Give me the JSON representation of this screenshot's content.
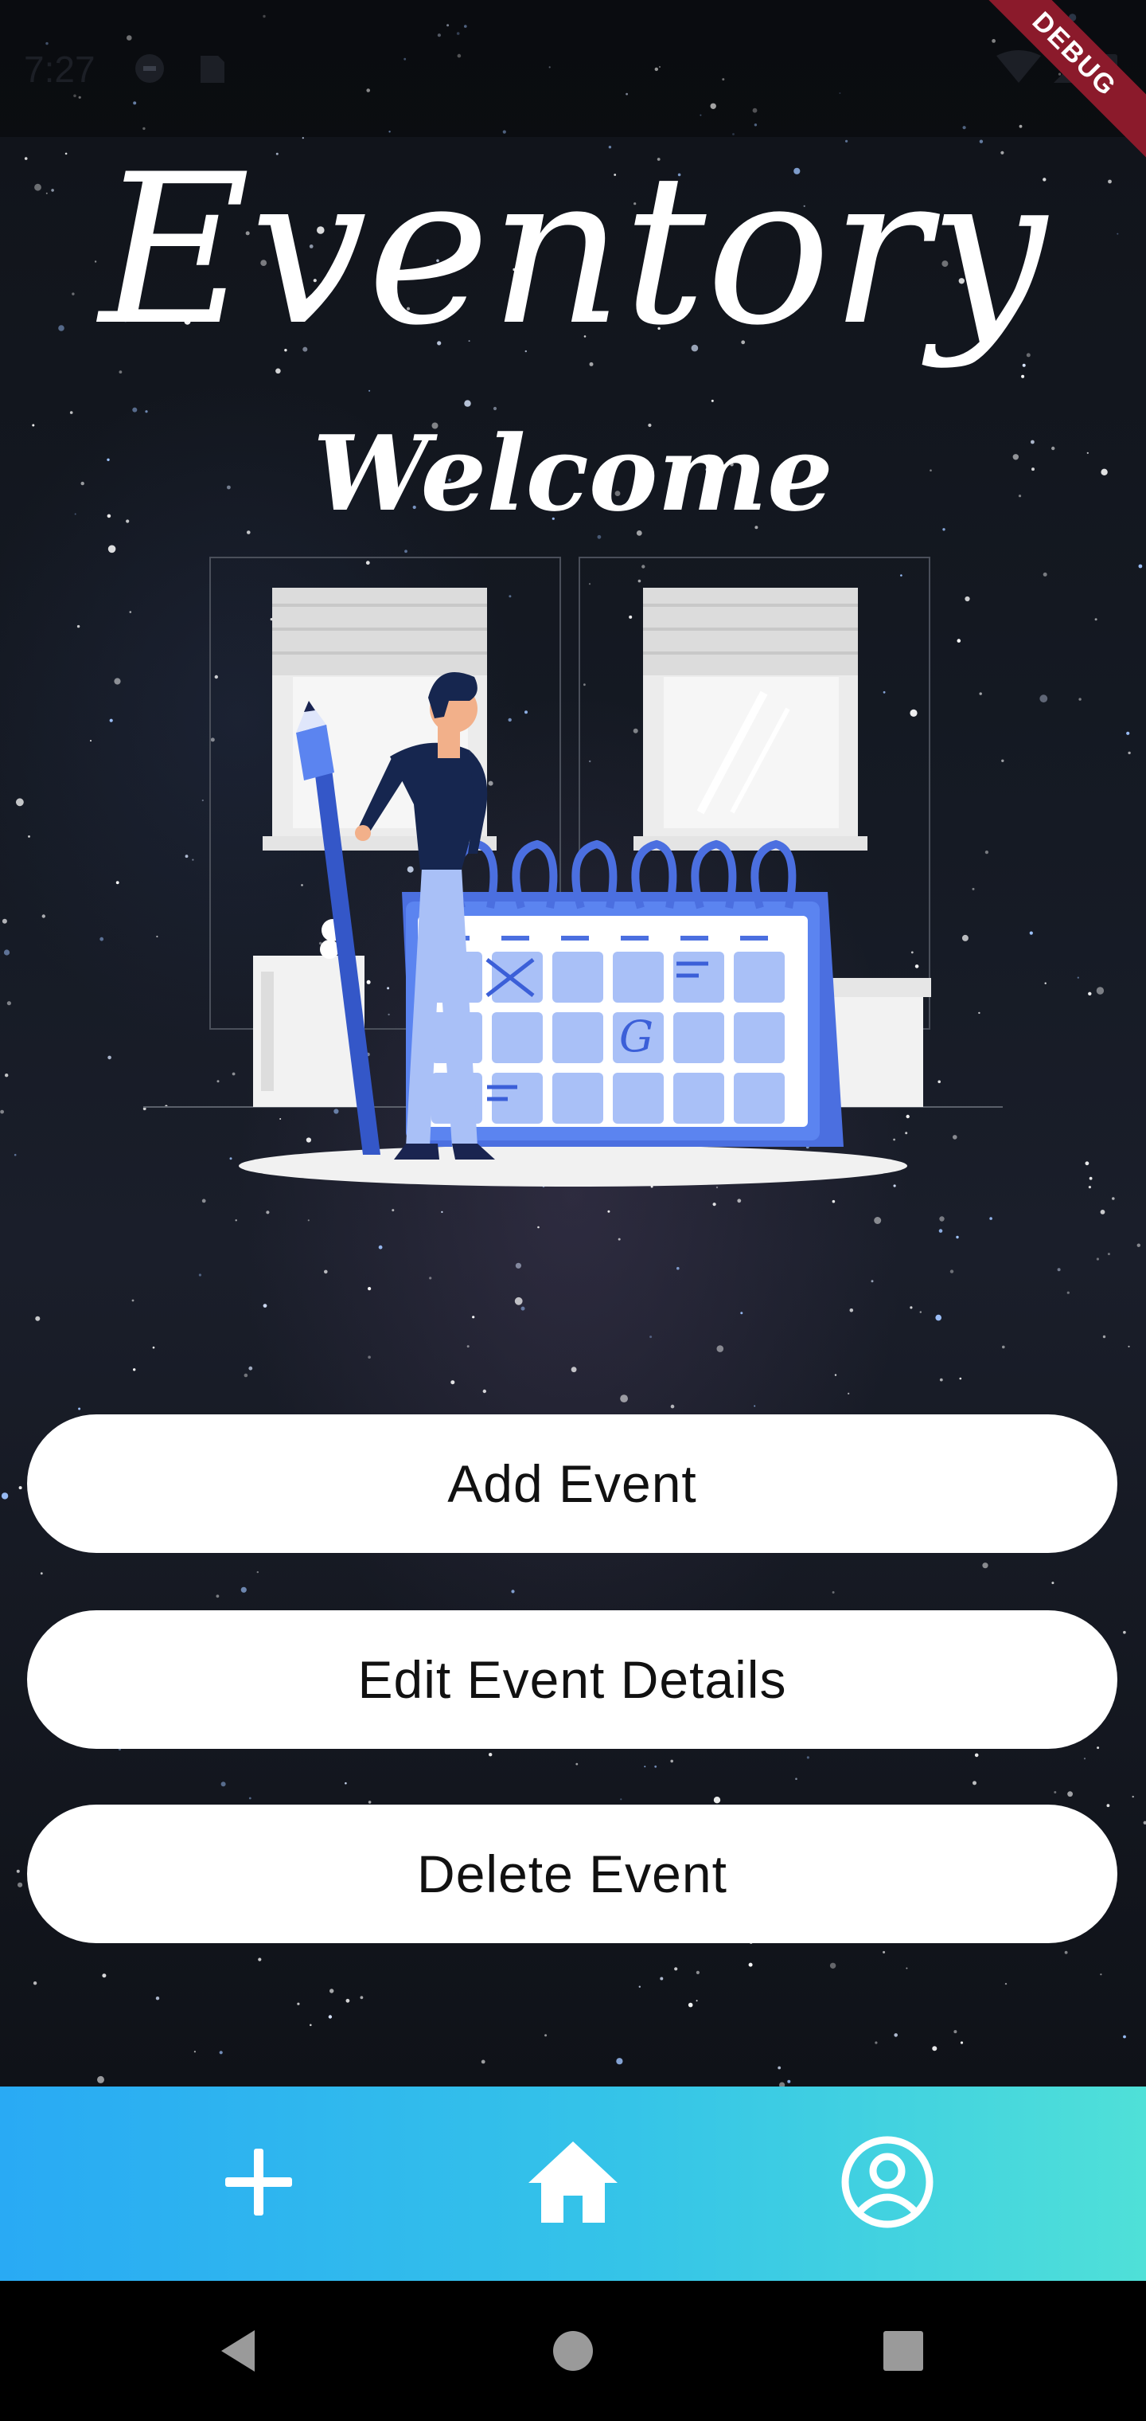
{
  "status_bar": {
    "time": "7:27",
    "left_icons": [
      "do-not-disturb-icon",
      "sd-card-icon"
    ],
    "right_icons": [
      "wifi-icon",
      "signal-icon",
      "battery-icon"
    ]
  },
  "debug_banner": "DEBUG",
  "app": {
    "title": "Eventory",
    "welcome": "Welcome"
  },
  "illustration": {
    "name": "man-with-pencil-and-calendar-illustration",
    "calendar_letter": "G"
  },
  "actions": {
    "add_label": "Add Event",
    "edit_label": "Edit Event Details",
    "delete_label": "Delete Event"
  },
  "bottom_nav": {
    "items": [
      {
        "icon": "plus-icon"
      },
      {
        "icon": "home-icon"
      },
      {
        "icon": "account-circle-icon"
      }
    ]
  },
  "system_nav": {
    "items": [
      "back-icon",
      "home-circle-icon",
      "recents-square-icon"
    ]
  },
  "colors": {
    "nav_gradient_start": "#29aaf4",
    "nav_gradient_end": "#4fe0d8",
    "button_bg": "#ffffff",
    "title_color": "#ffffff",
    "debug_banner": "#8b1a2b",
    "calendar_blue": "#5b84f0"
  }
}
